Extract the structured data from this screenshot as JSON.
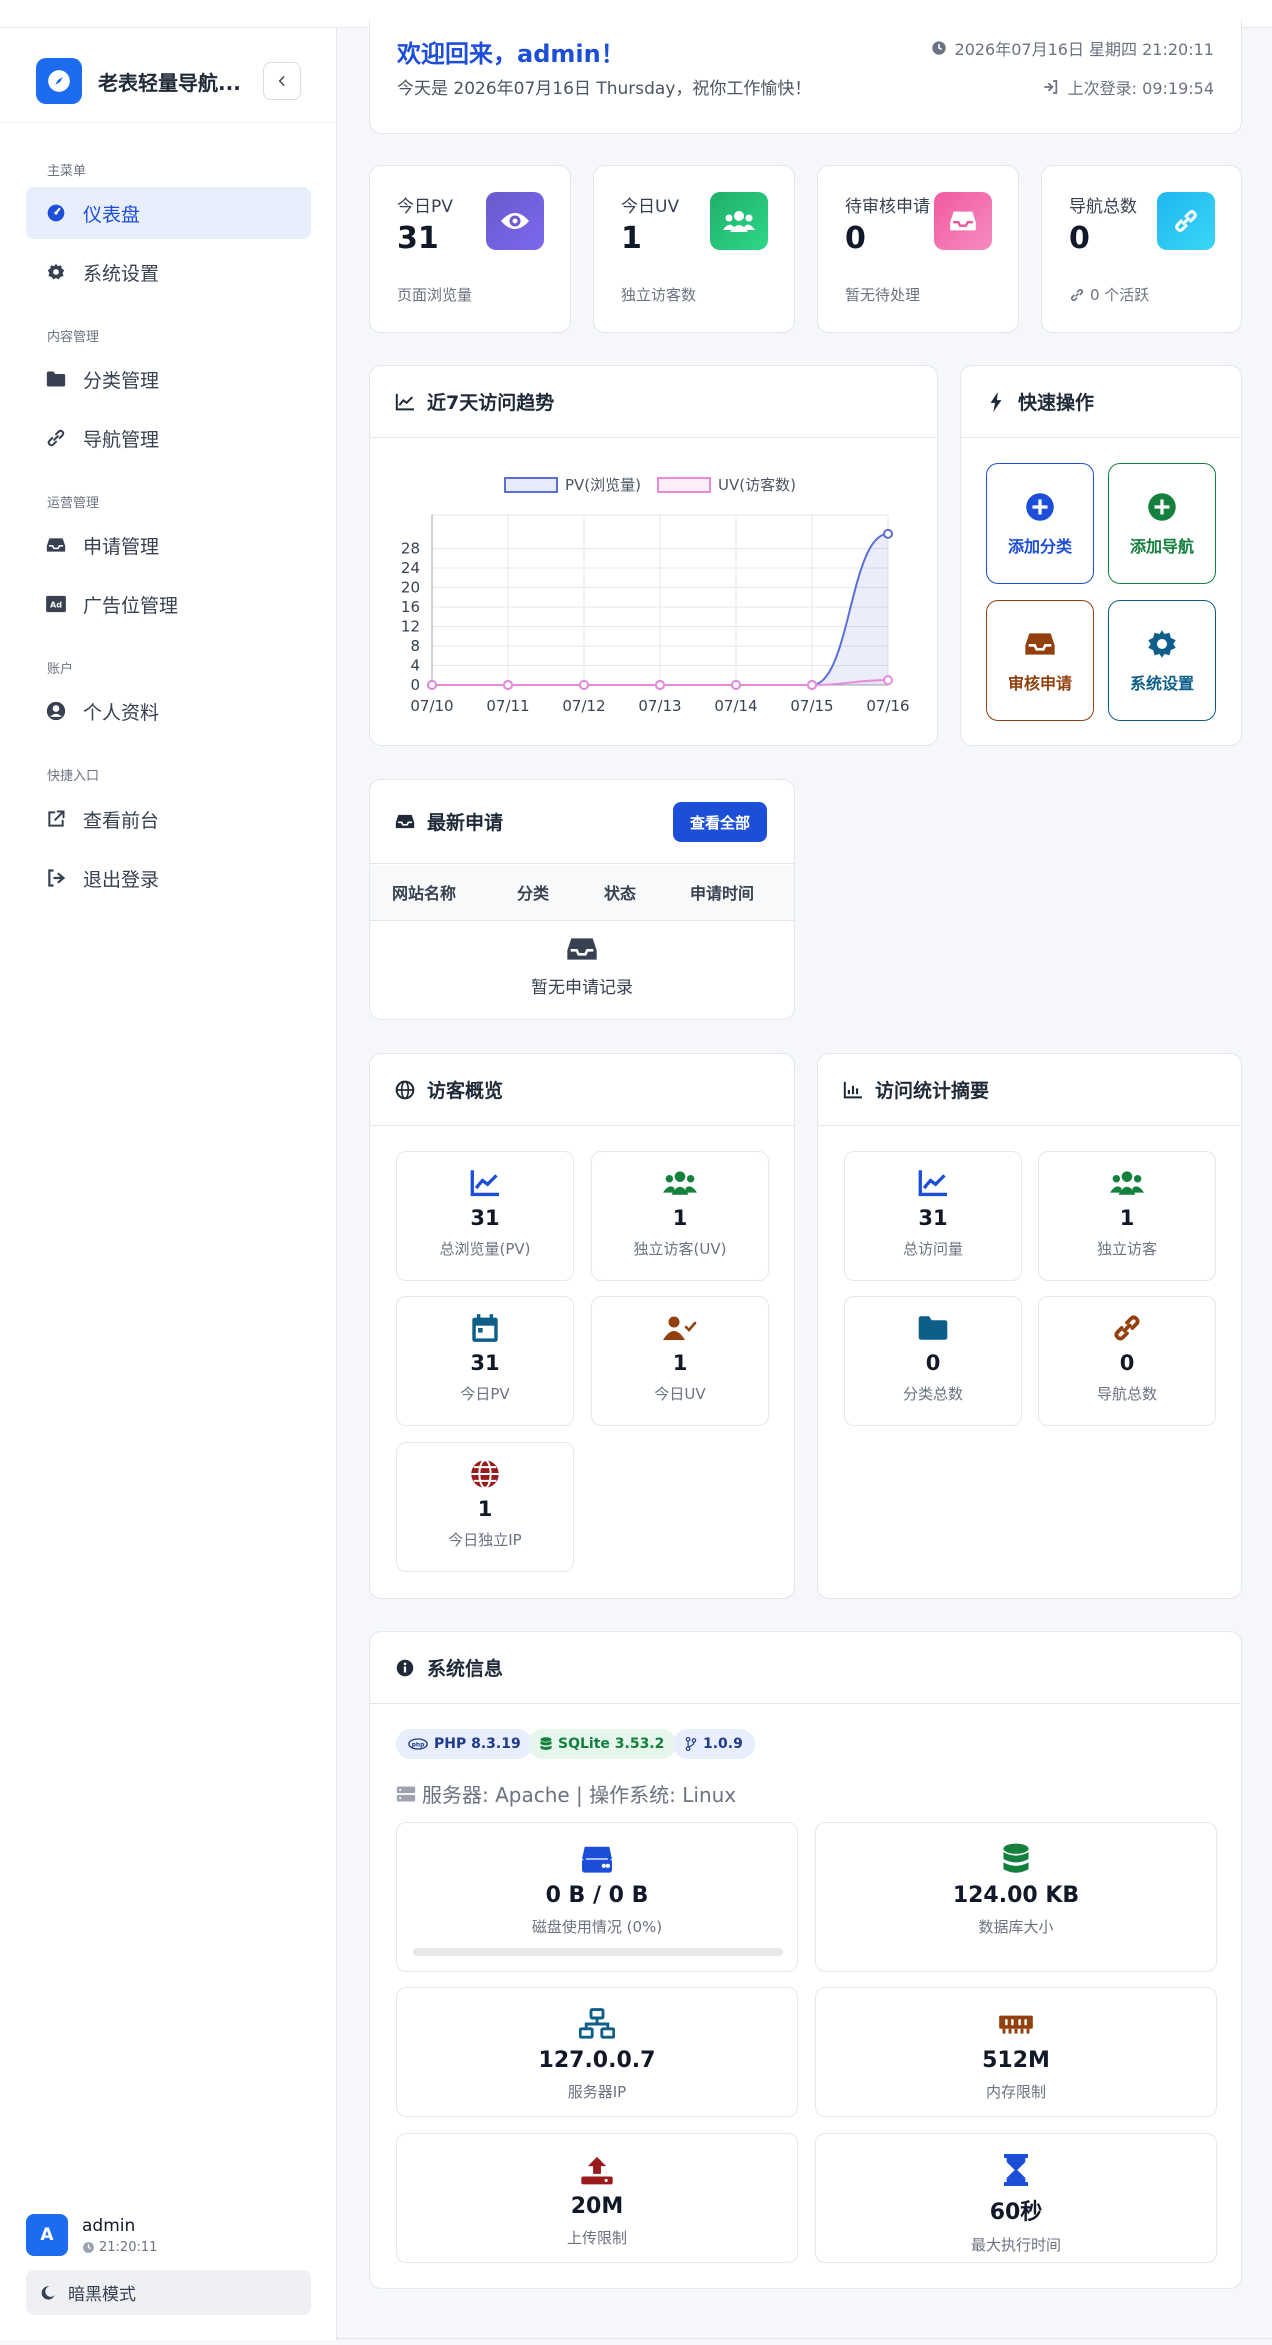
{
  "sidebar": {
    "brand": "老表轻量导航...",
    "sections": {
      "main": "主菜单",
      "content": "内容管理",
      "operation": "运营管理",
      "account": "账户",
      "quick": "快捷入口"
    },
    "items": [
      {
        "label": "仪表盘",
        "icon": "dashboard-icon"
      },
      {
        "label": "系统设置",
        "icon": "gear-icon"
      },
      {
        "label": "分类管理",
        "icon": "folder-icon"
      },
      {
        "label": "导航管理",
        "icon": "link-icon"
      },
      {
        "label": "申请管理",
        "icon": "inbox-icon"
      },
      {
        "label": "广告位管理",
        "icon": "ad-icon"
      },
      {
        "label": "个人资料",
        "icon": "user-circle-icon"
      },
      {
        "label": "查看前台",
        "icon": "external-link-icon"
      },
      {
        "label": "退出登录",
        "icon": "logout-icon"
      }
    ],
    "user": {
      "avatar": "A",
      "name": "admin",
      "time": "21:20:11"
    },
    "dark_mode": "暗黑模式"
  },
  "welcome": {
    "title": "欢迎回来，admin！",
    "subtitle": "今天是 2026年07月16日 Thursday，祝你工作愉快！",
    "datetime": "2026年07月16日 星期四 21:20:11",
    "last_login": "上次登录: 09:19:54"
  },
  "stats": [
    {
      "label": "今日PV",
      "value": "31",
      "desc": "页面浏览量",
      "color": "#6d5bd0"
    },
    {
      "label": "今日UV",
      "value": "1",
      "desc": "独立访客数",
      "color": "#22b573"
    },
    {
      "label": "待审核申请",
      "value": "0",
      "desc": "暂无待处理",
      "color": "#f0569a"
    },
    {
      "label": "导航总数",
      "value": "0",
      "desc": "0 个活跃",
      "color": "#22b8f0"
    }
  ],
  "trend": {
    "title": "近7天访问趋势"
  },
  "chart_data": {
    "type": "line",
    "x": [
      "07/10",
      "07/11",
      "07/12",
      "07/13",
      "07/14",
      "07/15",
      "07/16"
    ],
    "series": [
      {
        "name": "PV(浏览量)",
        "values": [
          0,
          0,
          0,
          0,
          0,
          0,
          31
        ],
        "color": "#5b6fd6"
      },
      {
        "name": "UV(访客数)",
        "values": [
          0,
          0,
          0,
          0,
          0,
          0,
          1
        ],
        "color": "#e58bd8"
      }
    ],
    "yticks": [
      0,
      4,
      8,
      12,
      16,
      20,
      24,
      28
    ],
    "ylim": [
      0,
      32
    ],
    "grid": true,
    "legend": "top"
  },
  "quick": {
    "title": "快速操作",
    "items": [
      {
        "label": "添加分类",
        "color": "#1d4ed8"
      },
      {
        "label": "添加导航",
        "color": "#15803d"
      },
      {
        "label": "审核申请",
        "color": "#92400e"
      },
      {
        "label": "系统设置",
        "color": "#0e5e8a"
      }
    ]
  },
  "applications": {
    "title": "最新申请",
    "view_all": "查看全部",
    "columns": [
      "网站名称",
      "分类",
      "状态",
      "申请时间"
    ],
    "empty": "暂无申请记录"
  },
  "visitors": {
    "title": "访客概览",
    "tiles": [
      {
        "value": "31",
        "label": "总浏览量(PV)"
      },
      {
        "value": "1",
        "label": "独立访客(UV)"
      },
      {
        "value": "31",
        "label": "今日PV"
      },
      {
        "value": "1",
        "label": "今日UV"
      },
      {
        "value": "1",
        "label": "今日独立IP"
      }
    ]
  },
  "summary": {
    "title": "访问统计摘要",
    "tiles": [
      {
        "value": "31",
        "label": "总访问量"
      },
      {
        "value": "1",
        "label": "独立访客"
      },
      {
        "value": "0",
        "label": "分类总数"
      },
      {
        "value": "0",
        "label": "导航总数"
      }
    ]
  },
  "system": {
    "title": "系统信息",
    "badges": {
      "php": "PHP 8.3.19",
      "sqlite": "SQLite 3.53.2",
      "version": "1.0.9"
    },
    "server": "服务器: Apache | 操作系统: Linux",
    "tiles": [
      {
        "value": "0 B / 0 B",
        "label": "磁盘使用情况 (0%)"
      },
      {
        "value": "124.00 KB",
        "label": "数据库大小"
      },
      {
        "value": "127.0.0.7",
        "label": "服务器IP"
      },
      {
        "value": "512M",
        "label": "内存限制"
      },
      {
        "value": "20M",
        "label": "上传限制"
      },
      {
        "value": "60秒",
        "label": "最大执行时间"
      }
    ],
    "disk_usage": 0
  }
}
